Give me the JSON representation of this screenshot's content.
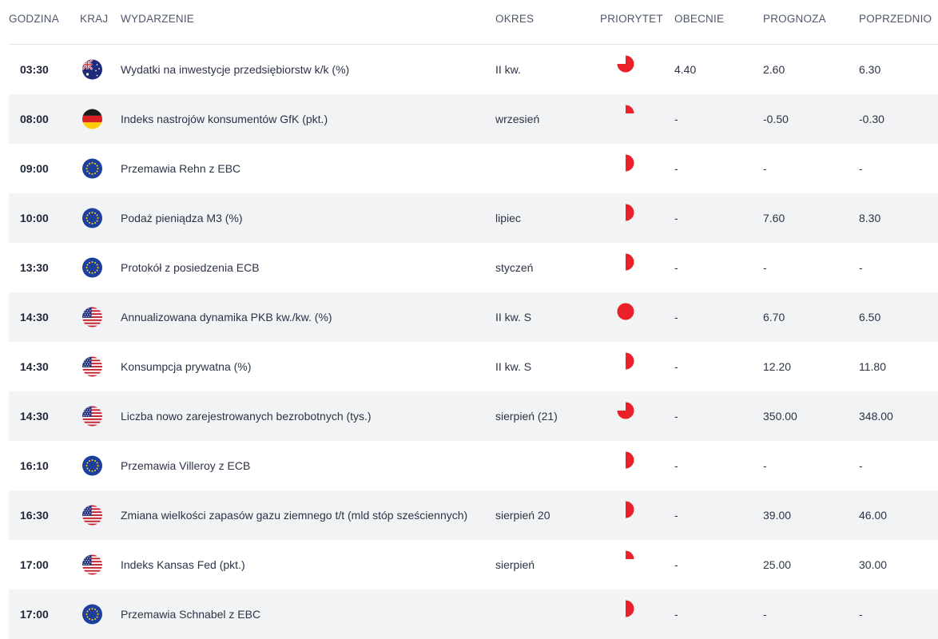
{
  "header": {
    "time": "GODZINA",
    "country": "KRAJ",
    "event": "WYDARZENIE",
    "period": "OKRES",
    "priority": "PRIORYTET",
    "actual": "OBECNIE",
    "forecast": "PROGNOZA",
    "previous": "POPRZEDNIO"
  },
  "colors": {
    "priority": "#ea2129",
    "alt_row": "#f2f3f5",
    "header_text": "#4f586b"
  },
  "rows": [
    {
      "time": "03:30",
      "country": "AU",
      "flag_icon": "australia-flag-icon",
      "event": "Wydatki na inwestycje przedsiębiorstw k/k (%)",
      "period": "II kw.",
      "priority": 0.75,
      "actual": "4.40",
      "forecast": "2.60",
      "previous": "6.30"
    },
    {
      "time": "08:00",
      "country": "DE",
      "flag_icon": "germany-flag-icon",
      "event": "Indeks nastrojów konsumentów GfK (pkt.)",
      "period": "wrzesień",
      "priority": 0.25,
      "actual": "-",
      "forecast": "-0.50",
      "previous": "-0.30"
    },
    {
      "time": "09:00",
      "country": "EU",
      "flag_icon": "eu-flag-icon",
      "event": "Przemawia Rehn z EBC",
      "period": "",
      "priority": 0.5,
      "actual": "-",
      "forecast": "-",
      "previous": "-"
    },
    {
      "time": "10:00",
      "country": "EU",
      "flag_icon": "eu-flag-icon",
      "event": "Podaż pieniądza M3 (%)",
      "period": "lipiec",
      "priority": 0.5,
      "actual": "-",
      "forecast": "7.60",
      "previous": "8.30"
    },
    {
      "time": "13:30",
      "country": "EU",
      "flag_icon": "eu-flag-icon",
      "event": "Protokół z posiedzenia ECB",
      "period": "styczeń",
      "priority": 0.5,
      "actual": "-",
      "forecast": "-",
      "previous": "-"
    },
    {
      "time": "14:30",
      "country": "US",
      "flag_icon": "usa-flag-icon",
      "event": "Annualizowana dynamika PKB kw./kw. (%)",
      "period": "II kw. S",
      "priority": 1.0,
      "actual": "-",
      "forecast": "6.70",
      "previous": "6.50"
    },
    {
      "time": "14:30",
      "country": "US",
      "flag_icon": "usa-flag-icon",
      "event": "Konsumpcja prywatna (%)",
      "period": "II kw. S",
      "priority": 0.5,
      "actual": "-",
      "forecast": "12.20",
      "previous": "11.80"
    },
    {
      "time": "14:30",
      "country": "US",
      "flag_icon": "usa-flag-icon",
      "event": "Liczba nowo zarejestrowanych bezrobotnych (tys.)",
      "period": "sierpień (21)",
      "priority": 0.75,
      "actual": "-",
      "forecast": "350.00",
      "previous": "348.00"
    },
    {
      "time": "16:10",
      "country": "EU",
      "flag_icon": "eu-flag-icon",
      "event": "Przemawia Villeroy z ECB",
      "period": "",
      "priority": 0.5,
      "actual": "-",
      "forecast": "-",
      "previous": "-"
    },
    {
      "time": "16:30",
      "country": "US",
      "flag_icon": "usa-flag-icon",
      "event": "Zmiana wielkości zapasów gazu ziemnego t/t (mld stóp sześciennych)",
      "period": "sierpień 20",
      "priority": 0.5,
      "actual": "-",
      "forecast": "39.00",
      "previous": "46.00"
    },
    {
      "time": "17:00",
      "country": "US",
      "flag_icon": "usa-flag-icon",
      "event": "Indeks Kansas Fed (pkt.)",
      "period": "sierpień",
      "priority": 0.25,
      "actual": "-",
      "forecast": "25.00",
      "previous": "30.00"
    },
    {
      "time": "17:00",
      "country": "EU",
      "flag_icon": "eu-flag-icon",
      "event": "Przemawia Schnabel z EBC",
      "period": "",
      "priority": 0.5,
      "actual": "-",
      "forecast": "-",
      "previous": "-"
    }
  ]
}
